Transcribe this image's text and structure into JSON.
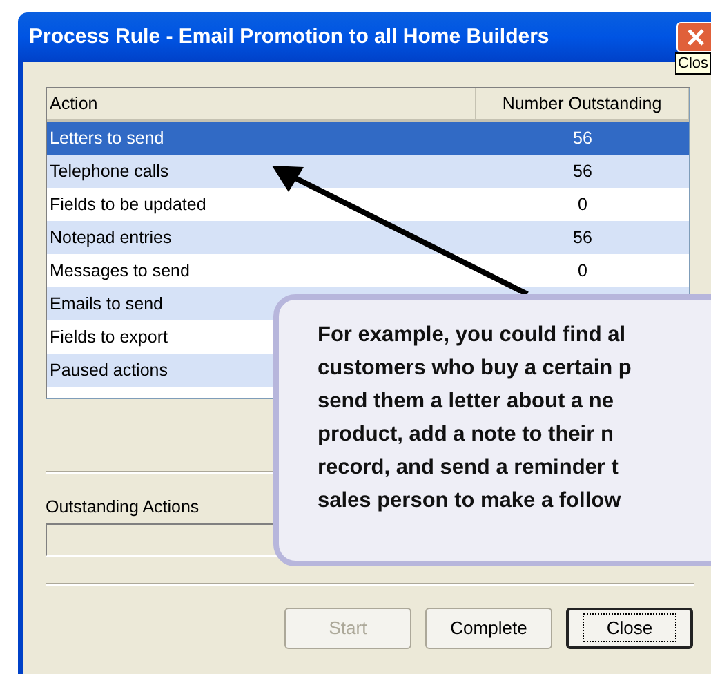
{
  "window": {
    "title": "Process Rule - Email Promotion to all Home Builders",
    "close_tooltip": "Clos"
  },
  "table": {
    "columns": [
      "Action",
      "Number Outstanding"
    ],
    "rows": [
      {
        "action": "Letters to send",
        "count": "56",
        "selected": true
      },
      {
        "action": "Telephone calls",
        "count": "56",
        "selected": false
      },
      {
        "action": "Fields to be updated",
        "count": "0",
        "selected": false
      },
      {
        "action": "Notepad entries",
        "count": "56",
        "selected": false
      },
      {
        "action": "Messages to send",
        "count": "0",
        "selected": false
      },
      {
        "action": "Emails to send",
        "selected": false
      },
      {
        "action": "Fields to export",
        "selected": false
      },
      {
        "action": "Paused actions",
        "selected": false
      }
    ]
  },
  "progress": {
    "label": "Outstanding Actions",
    "level": 0
  },
  "buttons": [
    {
      "label": "Start",
      "disabled": true,
      "default": false
    },
    {
      "label": "Complete",
      "disabled": false,
      "default": false
    },
    {
      "label": "Close",
      "disabled": false,
      "default": true
    }
  ],
  "callout": {
    "lines": [
      "For example, you could find al",
      "customers who buy a certain p",
      "send them a letter about a ne",
      "product, add a note to their n",
      "record, and send a reminder t",
      "sales person to make a follow"
    ]
  }
}
